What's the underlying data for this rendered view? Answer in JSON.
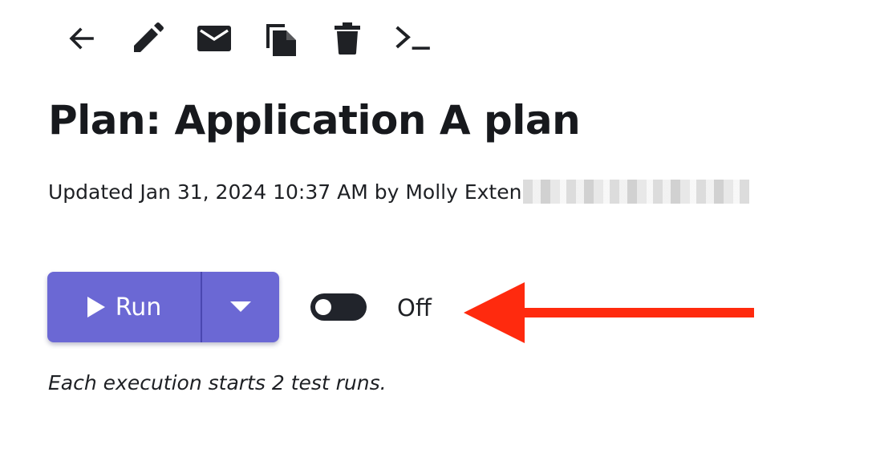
{
  "toolbar": {
    "icons": [
      "back-arrow-icon",
      "edit-pencil-icon",
      "email-icon",
      "copy-icon",
      "trash-icon",
      "terminal-icon"
    ]
  },
  "plan": {
    "title": "Plan: Application A plan",
    "updated_text": "Updated Jan 31, 2024 10:37 AM by Molly Exten"
  },
  "run_control": {
    "run_label": "Run",
    "toggle_label": "Off",
    "toggle_state": "off"
  },
  "execution_note": "Each execution starts 2 test runs.",
  "colors": {
    "run_button": "#6b68d4",
    "toggle_track": "#21242b",
    "annotation_arrow": "#ff2a0e"
  }
}
